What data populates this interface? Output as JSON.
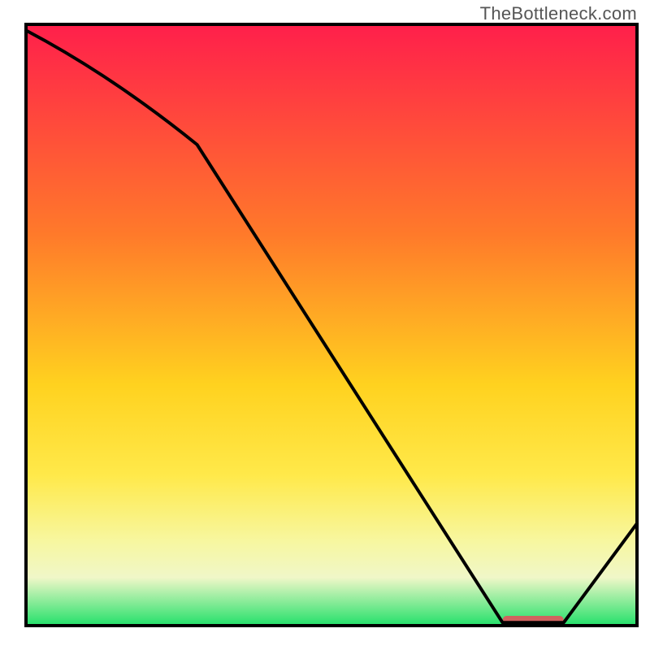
{
  "watermark": "TheBottleneck.com",
  "colors": {
    "gradient_top": "#ff1f4b",
    "gradient_mid1": "#ff7a2a",
    "gradient_mid2": "#ffd21f",
    "gradient_mid3": "#ffe94a",
    "gradient_mid4": "#f7f7a0",
    "gradient_bottom_band_top": "#f0f7c8",
    "gradient_bottom_band_bottom": "#23e06a",
    "frame": "#000000",
    "curve": "#000000",
    "optimal_marker": "#d1635f"
  },
  "chart_data": {
    "type": "line",
    "title": "",
    "xlabel": "",
    "ylabel": "",
    "xlim": [
      0,
      100
    ],
    "ylim": [
      0,
      100
    ],
    "x": [
      0,
      28,
      78,
      88,
      100
    ],
    "values": [
      99,
      80,
      0.5,
      0.5,
      17
    ],
    "optimal_range_x": [
      78,
      88
    ],
    "annotations": [
      {
        "text": "TheBottleneck.com",
        "role": "watermark"
      }
    ]
  }
}
